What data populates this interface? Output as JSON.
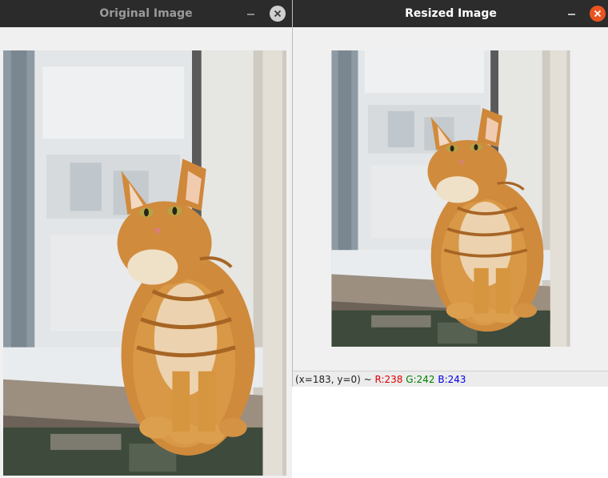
{
  "windows": {
    "original": {
      "title": "Original Image"
    },
    "resized": {
      "title": "Resized Image"
    }
  },
  "status_bar": {
    "coords": "(x=183, y=0) ~ ",
    "r": "R:238",
    "g": "G:242",
    "b": "B:243",
    "colors": {
      "r": "#e00000",
      "g": "#008000",
      "b": "#0000e0"
    }
  },
  "icons": {
    "minimize": "minimize-icon",
    "close": "close-icon"
  },
  "theme": {
    "titlebar": "#2c2c2c",
    "close_active": "#e95420",
    "close_inactive": "#d0d0d0"
  }
}
